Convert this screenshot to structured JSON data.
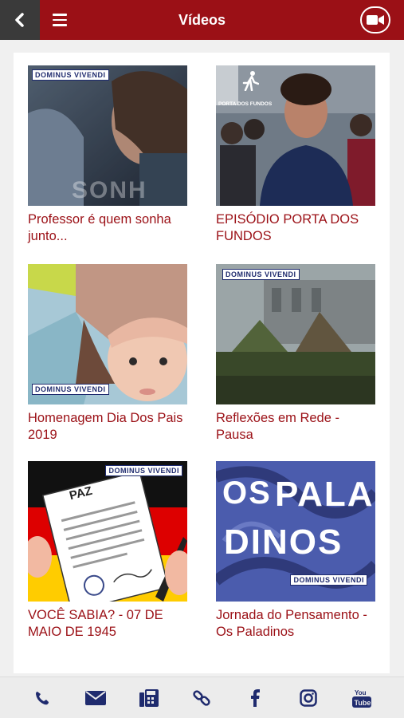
{
  "header": {
    "title": "Vídeos"
  },
  "videos": [
    {
      "caption": "Professor é quem sonha junto..."
    },
    {
      "caption": "EPISÓDIO PORTA DOS FUNDOS"
    },
    {
      "caption": "Homenagem Dia Dos Pais 2019"
    },
    {
      "caption": "Reflexões em Rede - Pausa"
    },
    {
      "caption": "VOCÊ SABIA? - 07 DE MAIO DE 1945"
    },
    {
      "caption": "Jornada do Pensamento - Os Paladinos"
    }
  ],
  "thumb_text": {
    "logo": "DOMINUS VIVENDI",
    "sonha": "SONH",
    "porta": "PORTA DOS FUNDOS",
    "paz": "PAZ",
    "paladinos_1": "OS",
    "paladinos_2": "PALA",
    "paladinos_3": "DINOS"
  },
  "colors": {
    "primary": "#9b1016",
    "back": "#3a3a3a",
    "icon": "#1f2b6e"
  },
  "bottom_icons": [
    "phone-icon",
    "mail-icon",
    "fax-icon",
    "link-icon",
    "facebook-icon",
    "instagram-icon",
    "youtube-icon"
  ]
}
